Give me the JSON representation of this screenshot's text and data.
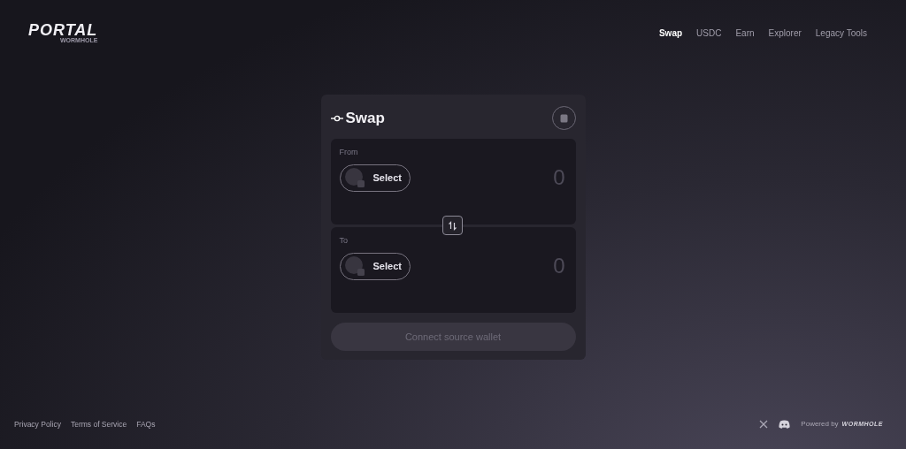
{
  "logo": {
    "title": "PORTAL",
    "subtitle": "WORMHOLE"
  },
  "nav": [
    {
      "label": "Swap",
      "selected": true
    },
    {
      "label": "USDC",
      "selected": false
    },
    {
      "label": "Earn",
      "selected": false
    },
    {
      "label": "Explorer",
      "selected": false
    },
    {
      "label": "Legacy Tools",
      "selected": false
    }
  ],
  "card": {
    "title": "Swap",
    "panels": [
      {
        "label": "From",
        "button": "Select",
        "amount": "0"
      },
      {
        "label": "To",
        "button": "Select",
        "amount": "0"
      }
    ],
    "action": {
      "label": "Connect source wallet",
      "disabled": true
    }
  },
  "footer": {
    "links": [
      "Privacy Policy",
      "Terms of Service",
      "FAQs"
    ],
    "powered_by": "Powered by",
    "brand": "WORMHOLE"
  }
}
